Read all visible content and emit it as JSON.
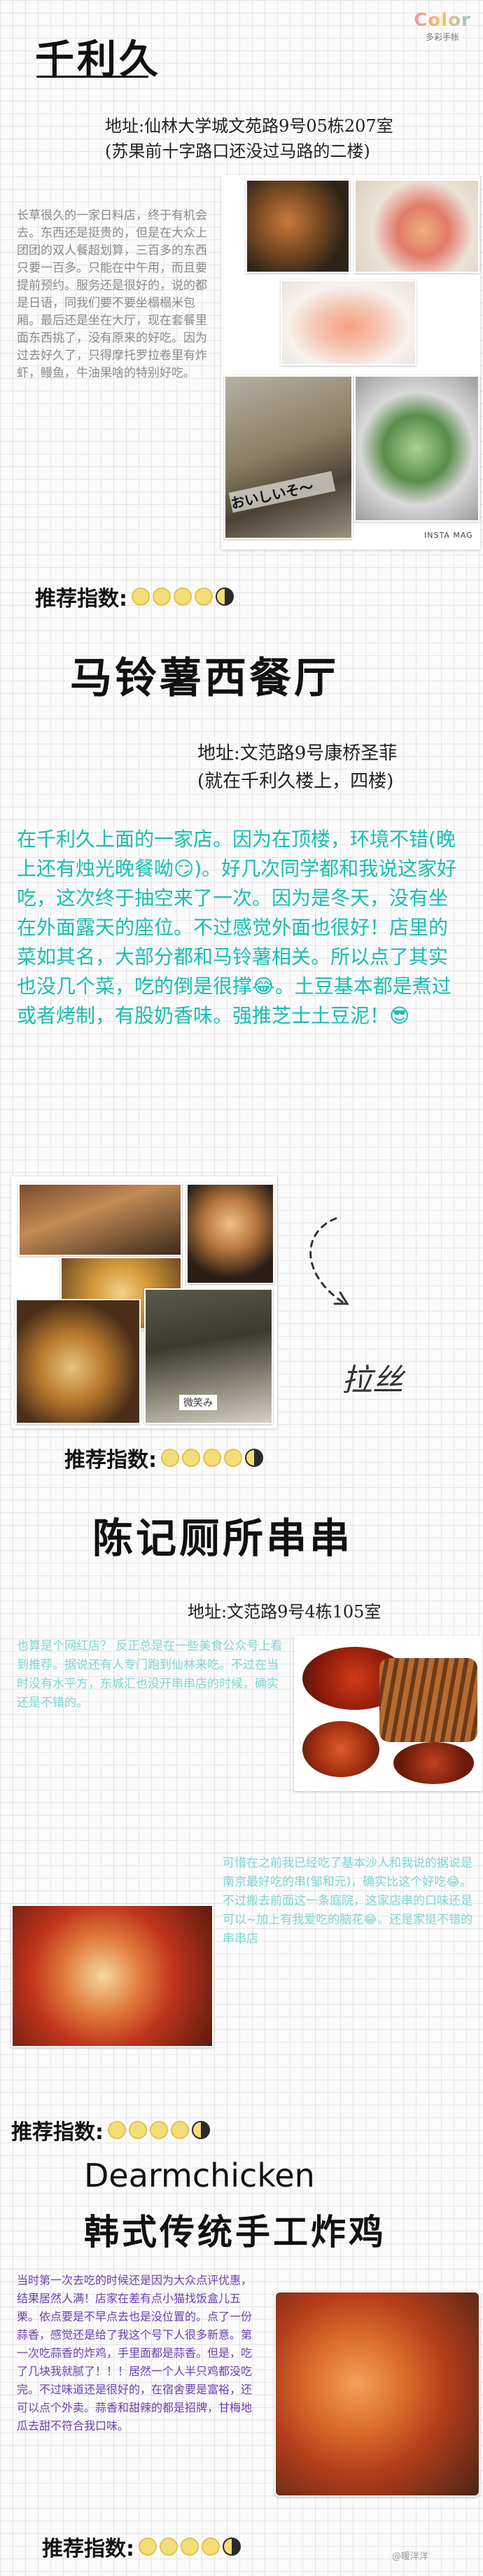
{
  "brand": {
    "logo": "Color",
    "sub": "多彩手帐"
  },
  "s1": {
    "title": "千利久",
    "addr1": "地址:仙林大学城文苑路9号05栋207室",
    "addr2": "(苏果前十字路口还没过马路的二楼)",
    "desc": "长草很久的一家日料店，终于有机会去。东西还是挺贵的，但是在大众上团团的双人餐超划算，三百多的东西只要一百多。只能在中午用，而且要提前预约。服务还是很好的，说的都是日语，同我们要不要坐榻榻米包厢。最后还是坐在大厅，现在套餐里面东西挑了，没有原来的好吃。因为过去好久了，只得摩托罗拉卷里有炸虾，鳗鱼，牛油果啥的特别好吃。",
    "photo_caption": "おいしいそ～",
    "watermark": "INSTA MAG",
    "rating_label": "推荐指数:"
  },
  "s2": {
    "title": "马铃薯西餐厅",
    "addr1": "地址:文范路9号康桥圣菲",
    "addr2": "(就在千利久楼上，四楼)",
    "desc": "在千利久上面的一家店。因为在顶楼，环境不错(晚上还有烛光晚餐呦😏)。好几次同学都和我说这家好吃，这次终于抽空来了一次。因为是冬天，没有坐在外面露天的座位。不过感觉外面也很好！店里的菜如其名，大部分都和马铃薯相关。所以点了其实也没几个菜，吃的倒是很撑😂。土豆基本都是煮过或者烤制，有股奶香味。强推芝士土豆泥！😎",
    "handwriting": "拉丝",
    "photo_caption": "微笑み",
    "rating_label": "推荐指数:"
  },
  "s3": {
    "title": "陈记厕所串串",
    "addr": "地址:文范路9号4栋105室",
    "desc1": "也算是个网红店？ 反正总是在一些美食公众号上看到推荐。据说还有人专门跑到仙林来吃。不过在当时没有水平方，东城汇也没开串串店的时候，确实还是不错的。",
    "desc2": "可惜在之前我已经吃了基本沙人和我说的据说是南京最好吃的串(邹和元)，确实比这个好吃😂。不过搬去前面这一条庭院，这家店串的口味还是可以~加上有我爱吃的脑花😂。还是家挺不错的串串店",
    "rating_label": "推荐指数:"
  },
  "s4": {
    "title1": "Dearmchicken",
    "title2": "韩式传统手工炸鸡",
    "desc": "当时第一次去吃的时候还是因为大众点评优惠，结果居然人满！店家在差有点小猫找饭盒儿五栗。依点要是不早点去也是没位置的。点了一份蒜香，感觉还是给了我这个号下人很多新意。第一次吃蒜香的炸鸡，手里面都是蒜香。但是，吃了几块我就腻了！！！居然一个人半只鸡都没吃完。不过味道还是很好的，在宿舍要是富裕，还可以点个外卖。蒜香和甜辣的都是招牌，甘梅地瓜去甜不符合我口味。",
    "rating_label": "推荐指数:",
    "watermark": "@暖洋洋"
  },
  "ratings": {
    "s1": 4.5,
    "s2": 4.5,
    "s3": 4.5,
    "s4": 4.5
  }
}
